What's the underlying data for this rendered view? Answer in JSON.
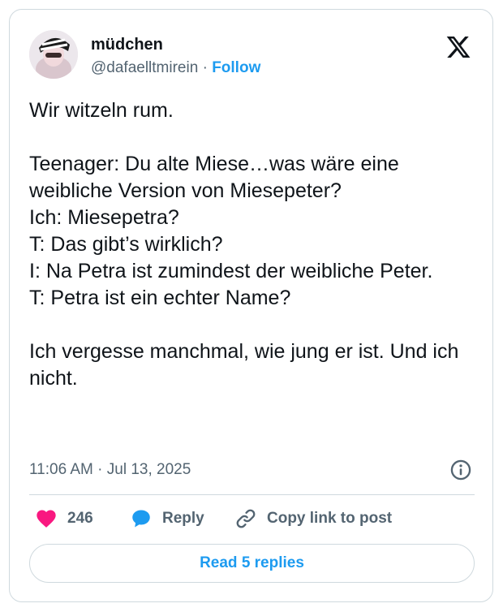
{
  "author": {
    "display_name": "müdchen",
    "handle": "@dafaelltmirein",
    "separator": "·",
    "follow_label": "Follow"
  },
  "tweet": {
    "text": "Wir witzeln rum.\n\nTeenager: Du alte Miese…was wäre eine weibliche Version von Miesepeter?\nIch: Miesepetra?\nT: Das gibt’s wirklich?\nI: Na Petra ist zumindest der weibliche Peter.\nT: Petra ist ein echter Name?\n\nIch vergesse manchmal, wie jung er ist. Und ich nicht.",
    "timestamp": "11:06 AM · Jul 13, 2025"
  },
  "actions": {
    "like_count": "246",
    "reply_label": "Reply",
    "copy_label": "Copy link to post"
  },
  "read_replies_label": "Read 5 replies",
  "icons": {
    "brand": "x-logo-icon",
    "like": "heart-icon",
    "reply": "speech-bubble-icon",
    "copy": "link-icon",
    "info": "info-icon"
  },
  "colors": {
    "accent": "#1d9bf0",
    "like": "#f91880",
    "secondary_text": "#536471",
    "border": "#cfd9de"
  }
}
